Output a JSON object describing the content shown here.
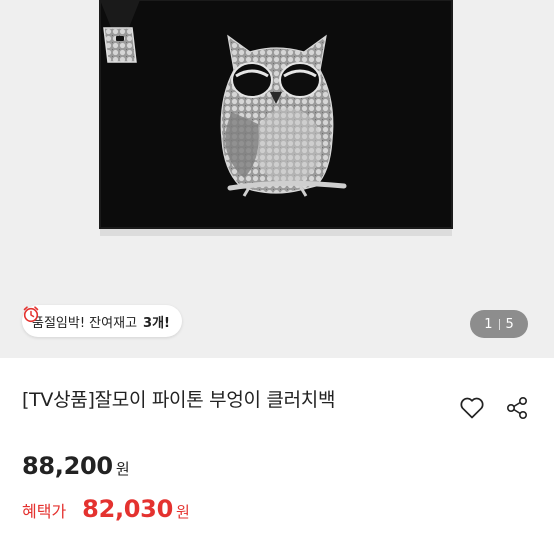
{
  "product_image": {
    "alt": "owl python clutch bag",
    "colors": {
      "background": "#efefef",
      "bag": "#0c0c0c",
      "snakeskin": "#b9b9b9"
    }
  },
  "stock_badge": {
    "icon": "alarm-clock-icon",
    "text": "품절임박! 잔여재고",
    "count": "3개!"
  },
  "pager": {
    "current": "1",
    "total": "5"
  },
  "product": {
    "title": "[TV상품]잘모이 파이톤 부엉이 클러치백",
    "price": "88,200",
    "currency": "원",
    "benefit_label": "혜택가",
    "benefit_price": "82,030",
    "benefit_currency": "원"
  },
  "icons": {
    "wishlist": "heart-outline-icon",
    "share": "share-icon"
  },
  "colors": {
    "accent_red": "#e4322f",
    "text": "#222222"
  }
}
